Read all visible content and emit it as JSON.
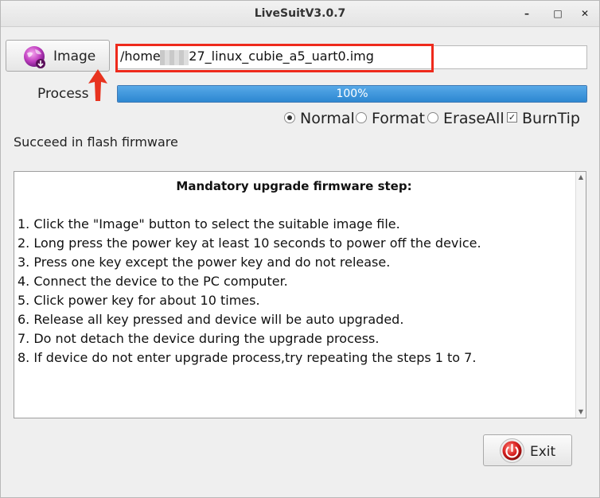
{
  "window": {
    "title": "LiveSuitV3.0.7",
    "minimize_glyph": "–",
    "maximize_glyph": "□",
    "close_glyph": "✕"
  },
  "image_button": {
    "label": "Image",
    "icon": "globe-disk-icon"
  },
  "path_input": {
    "value": "/home,      /a527_linux_cubie_a5_uart0.img"
  },
  "process": {
    "label": "Process",
    "percent": 100,
    "percent_text": "100%"
  },
  "options": {
    "normal": {
      "label": "Normal",
      "selected": true
    },
    "format": {
      "label": "Format",
      "selected": false
    },
    "erase_all": {
      "label": "EraseAll",
      "selected": false
    },
    "burn_tip": {
      "label": "BurnTip",
      "checked": true
    }
  },
  "status": {
    "text": "Succeed in flash firmware"
  },
  "instructions": {
    "heading": "Mandatory upgrade firmware step:",
    "steps": [
      "1. Click the \"Image\" button to select the suitable image file.",
      "2. Long press the power key at least 10 seconds to power off the device.",
      "3. Press one key except the power key and do not release.",
      "4. Connect the device to the PC computer.",
      "5. Click power key for about 10 times.",
      "6. Release all key pressed and device will be auto upgraded.",
      "7. Do not detach the device during the upgrade process.",
      "8. If device do not enter upgrade process,try repeating the steps 1 to 7."
    ]
  },
  "exit_button": {
    "label": "Exit",
    "icon": "power-exit-icon"
  },
  "colors": {
    "highlight": "#ee2a1c",
    "progress_fill": "#2d87d1",
    "annotation_arrow": "#e8331f"
  }
}
